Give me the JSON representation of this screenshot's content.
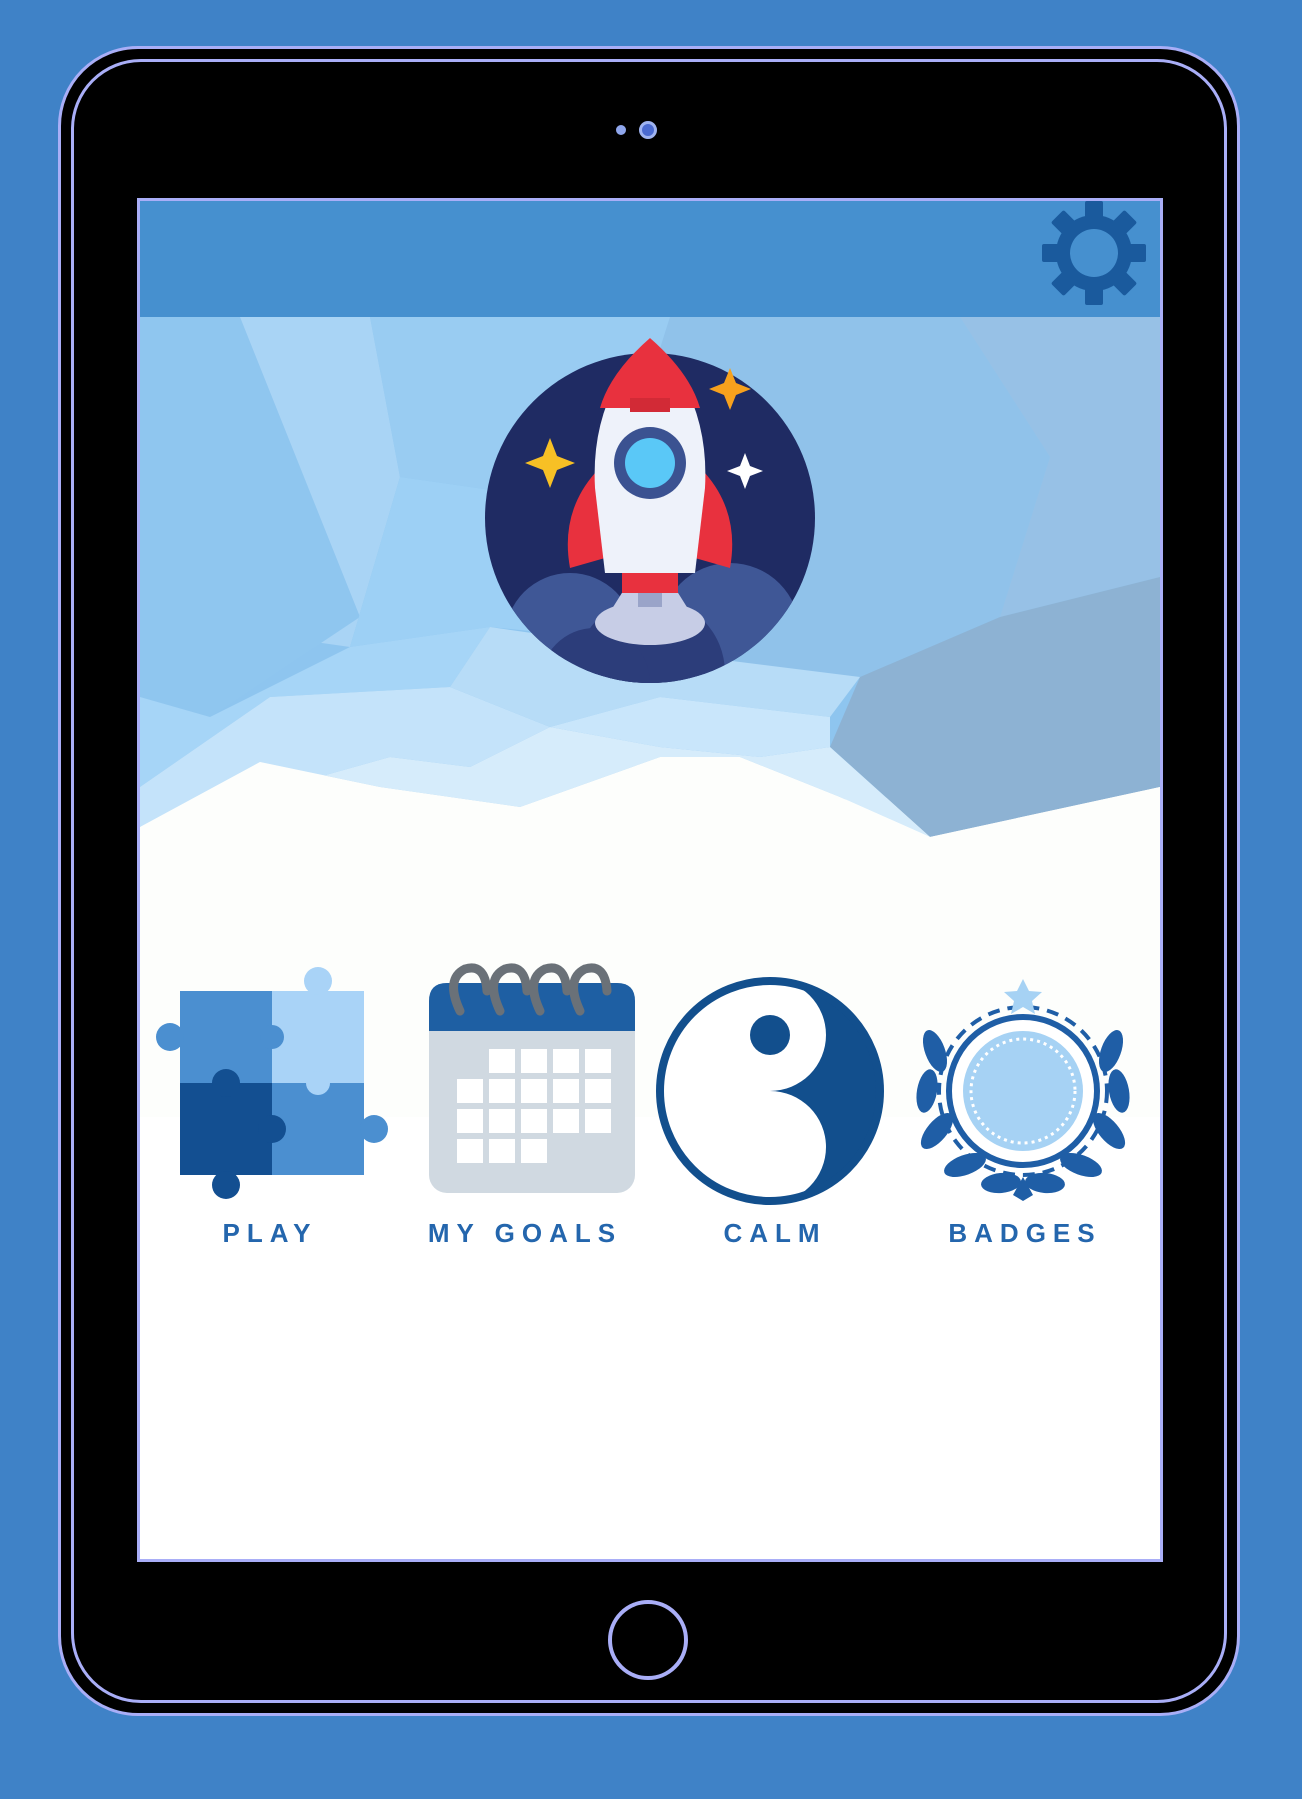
{
  "device": {
    "type": "tablet"
  },
  "topbar": {
    "settings_icon": "gear-icon"
  },
  "hero": {
    "icon": "rocket-icon"
  },
  "menu": [
    {
      "label": "PLAY",
      "icon": "puzzle-icon"
    },
    {
      "label": "MY GOALS",
      "icon": "calendar-icon"
    },
    {
      "label": "CALM",
      "icon": "yin-yang-icon"
    },
    {
      "label": "BADGES",
      "icon": "laurel-badge-icon"
    }
  ],
  "colors": {
    "background": "#3f82c7",
    "topbar": "#4690cf",
    "accent": "#2466ad",
    "device_outline": "#a9aef7"
  }
}
